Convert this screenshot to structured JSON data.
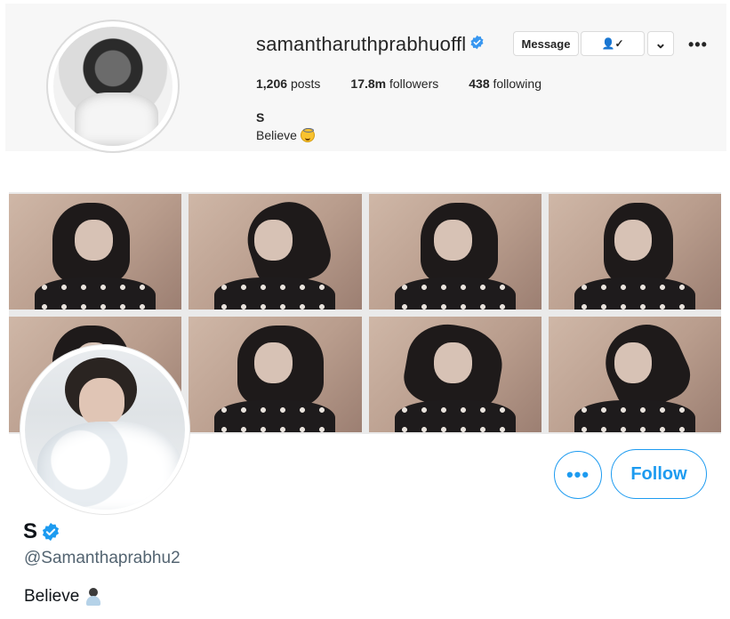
{
  "instagram": {
    "username": "samantharuthprabhuoffl",
    "message_button": "Message",
    "follow_status_glyph": "👤✓",
    "dropdown_glyph": "⌄",
    "more_glyph": "•••",
    "stats": {
      "posts_count": "1,206",
      "posts_label": "posts",
      "followers_count": "17.8m",
      "followers_label": "followers",
      "following_count": "438",
      "following_label": "following"
    },
    "name": "S",
    "bio": "Believe"
  },
  "twitter": {
    "more_glyph": "•••",
    "follow_button": "Follow",
    "name": "S",
    "handle": "@Samanthaprabhu2",
    "bio": "Believe"
  },
  "colors": {
    "twitter_blue": "#1d9bf0",
    "verified_blue": "#3897f0"
  }
}
